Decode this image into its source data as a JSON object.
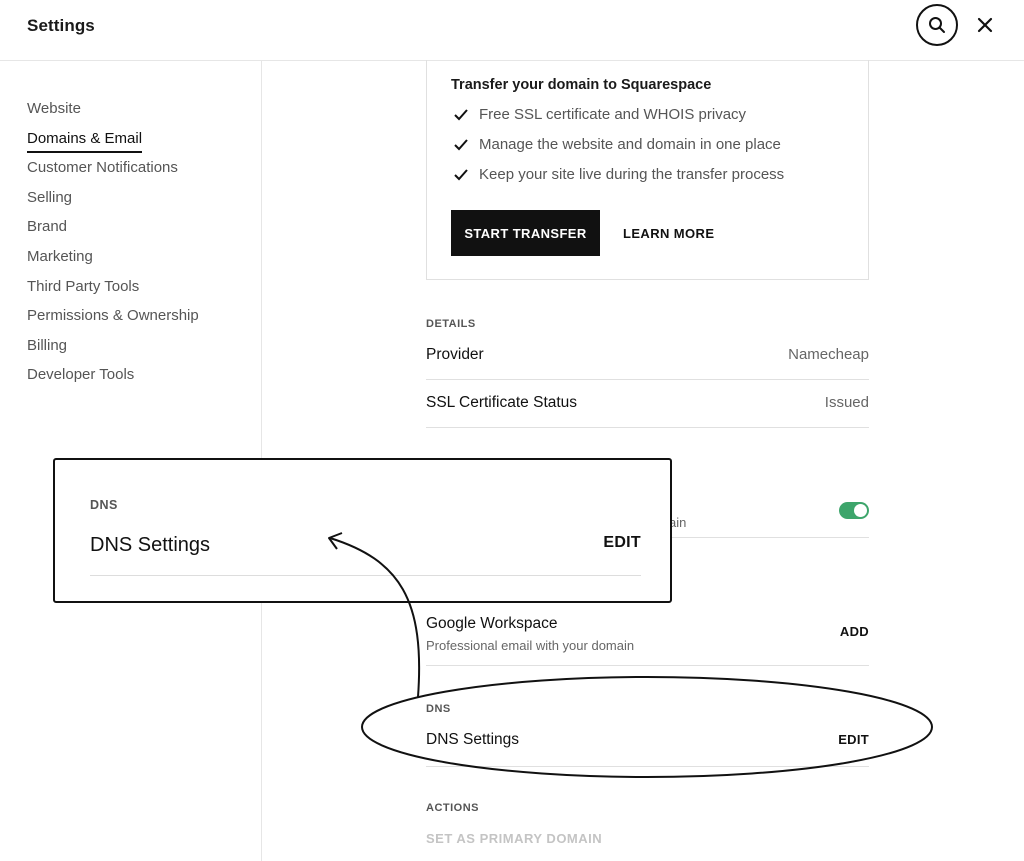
{
  "header": {
    "title": "Settings",
    "search_icon": "search-icon",
    "close_icon": "close-icon"
  },
  "sidebar": {
    "items": [
      {
        "label": "Website",
        "active": false
      },
      {
        "label": "Domains & Email",
        "active": true
      },
      {
        "label": "Customer Notifications",
        "active": false
      },
      {
        "label": "Selling",
        "active": false
      },
      {
        "label": "Brand",
        "active": false
      },
      {
        "label": "Marketing",
        "active": false
      },
      {
        "label": "Third Party Tools",
        "active": false
      },
      {
        "label": "Permissions & Ownership",
        "active": false
      },
      {
        "label": "Billing",
        "active": false
      },
      {
        "label": "Developer Tools",
        "active": false
      }
    ]
  },
  "transfer": {
    "title": "Transfer your domain to Squarespace",
    "features": [
      "Free SSL certificate and WHOIS privacy",
      "Manage the website and domain in one place",
      "Keep your site live during the transfer process"
    ],
    "start_button": "START TRANSFER",
    "learn_more": "LEARN MORE"
  },
  "details": {
    "label": "DETAILS",
    "rows": [
      {
        "label": "Provider",
        "value": "Namecheap"
      },
      {
        "label": "SSL Certificate Status",
        "value": "Issued"
      }
    ]
  },
  "partial_row": {
    "visible_text": "ain",
    "toggle_on": true,
    "toggle_color": "#3da56b"
  },
  "email": {
    "title": "Google Workspace",
    "subtitle": "Professional email with your domain",
    "action": "ADD"
  },
  "dns": {
    "label": "DNS",
    "row_label": "DNS Settings",
    "action": "EDIT"
  },
  "actions": {
    "label": "ACTIONS",
    "primary": "SET AS PRIMARY DOMAIN"
  },
  "zoom": {
    "label": "DNS",
    "title": "DNS Settings",
    "action": "EDIT"
  }
}
